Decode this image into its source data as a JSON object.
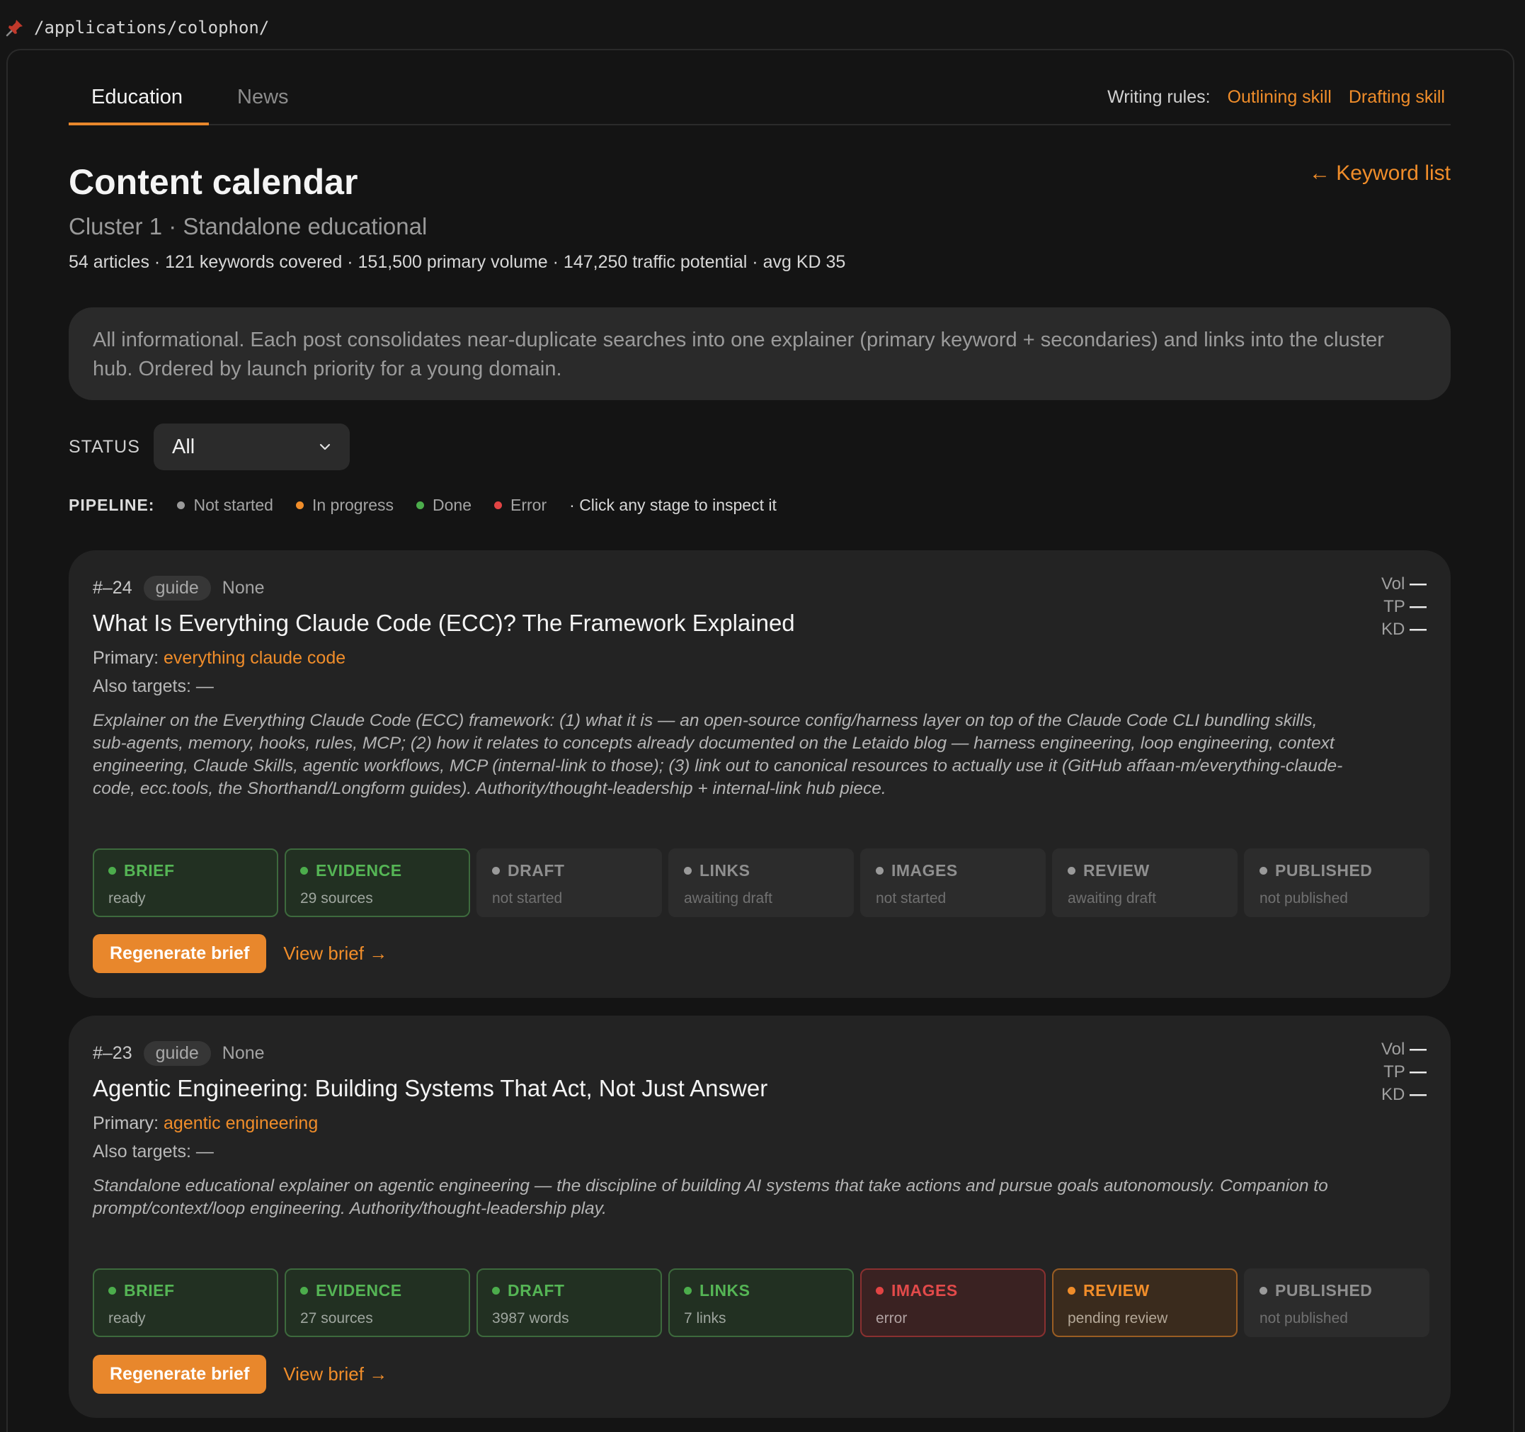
{
  "path": "/applications/colophon/",
  "tabs": [
    {
      "label": "Education"
    },
    {
      "label": "News"
    }
  ],
  "writing_rules": {
    "label": "Writing rules:",
    "links": [
      "Outlining skill",
      "Drafting skill"
    ]
  },
  "header": {
    "title": "Content calendar",
    "back_link": "← Keyword list",
    "subtitle": "Cluster 1 · Standalone educational",
    "stats": "54 articles · 121 keywords covered · 151,500 primary volume · 147,250 traffic potential · avg KD 35"
  },
  "note": "All informational. Each post consolidates near-duplicate searches into one explainer (primary keyword + secondaries) and links into the cluster hub. Ordered by launch priority for a young domain.",
  "filter": {
    "label": "STATUS",
    "value": "All"
  },
  "pipeline": {
    "label": "PIPELINE:",
    "legend": [
      {
        "label": "Not started",
        "color": "#9a9a9a"
      },
      {
        "label": "In progress",
        "color": "#f08d2a"
      },
      {
        "label": "Done",
        "color": "#4cad4c"
      },
      {
        "label": "Error",
        "color": "#e24444"
      }
    ],
    "hint": "· Click any stage to inspect it"
  },
  "cards": [
    {
      "num": "#–24",
      "tag": "guide",
      "category": "None",
      "metrics": {
        "vol": "Vol",
        "tp": "TP",
        "kd": "KD",
        "dash": "—"
      },
      "title": "What Is Everything Claude Code (ECC)? The Framework Explained",
      "primary_label": "Primary:",
      "primary_kw": "everything claude code",
      "also_targets": "Also targets: —",
      "description": "Explainer on the Everything Claude Code (ECC) framework: (1) what it is — an open-source config/harness layer on top of the Claude Code CLI bundling skills, sub-agents, memory, hooks, rules, MCP; (2) how it relates to concepts already documented on the Letaido blog — harness engineering, loop engineering, context engineering, Claude Skills, agentic workflows, MCP (internal-link to those); (3) link out to canonical resources to actually use it (GitHub affaan-m/everything-claude-code, ecc.tools, the Shorthand/Longform guides). Authority/thought-leadership + internal-link hub piece.",
      "stages": [
        {
          "name": "BRIEF",
          "status": "ready",
          "state": "done"
        },
        {
          "name": "EVIDENCE",
          "status": "29 sources",
          "state": "done"
        },
        {
          "name": "DRAFT",
          "status": "not started",
          "state": "not-started"
        },
        {
          "name": "LINKS",
          "status": "awaiting draft",
          "state": "not-started"
        },
        {
          "name": "IMAGES",
          "status": "not started",
          "state": "not-started"
        },
        {
          "name": "REVIEW",
          "status": "awaiting draft",
          "state": "not-started"
        },
        {
          "name": "PUBLISHED",
          "status": "not published",
          "state": "not-started"
        }
      ],
      "button": "Regenerate brief",
      "view_link": "View brief →"
    },
    {
      "num": "#–23",
      "tag": "guide",
      "category": "None",
      "metrics": {
        "vol": "Vol",
        "tp": "TP",
        "kd": "KD",
        "dash": "—"
      },
      "title": "Agentic Engineering: Building Systems That Act, Not Just Answer",
      "primary_label": "Primary:",
      "primary_kw": "agentic engineering",
      "also_targets": "Also targets: —",
      "description": "Standalone educational explainer on agentic engineering — the discipline of building AI systems that take actions and pursue goals autonomously. Companion to prompt/context/loop engineering. Authority/thought-leadership play.",
      "stages": [
        {
          "name": "BRIEF",
          "status": "ready",
          "state": "done"
        },
        {
          "name": "EVIDENCE",
          "status": "27 sources",
          "state": "done"
        },
        {
          "name": "DRAFT",
          "status": "3987 words",
          "state": "done"
        },
        {
          "name": "LINKS",
          "status": "7 links",
          "state": "done"
        },
        {
          "name": "IMAGES",
          "status": "error",
          "state": "error"
        },
        {
          "name": "REVIEW",
          "status": "pending review",
          "state": "progress"
        },
        {
          "name": "PUBLISHED",
          "status": "not published",
          "state": "not-started"
        }
      ],
      "button": "Regenerate brief",
      "view_link": "View brief →"
    }
  ]
}
